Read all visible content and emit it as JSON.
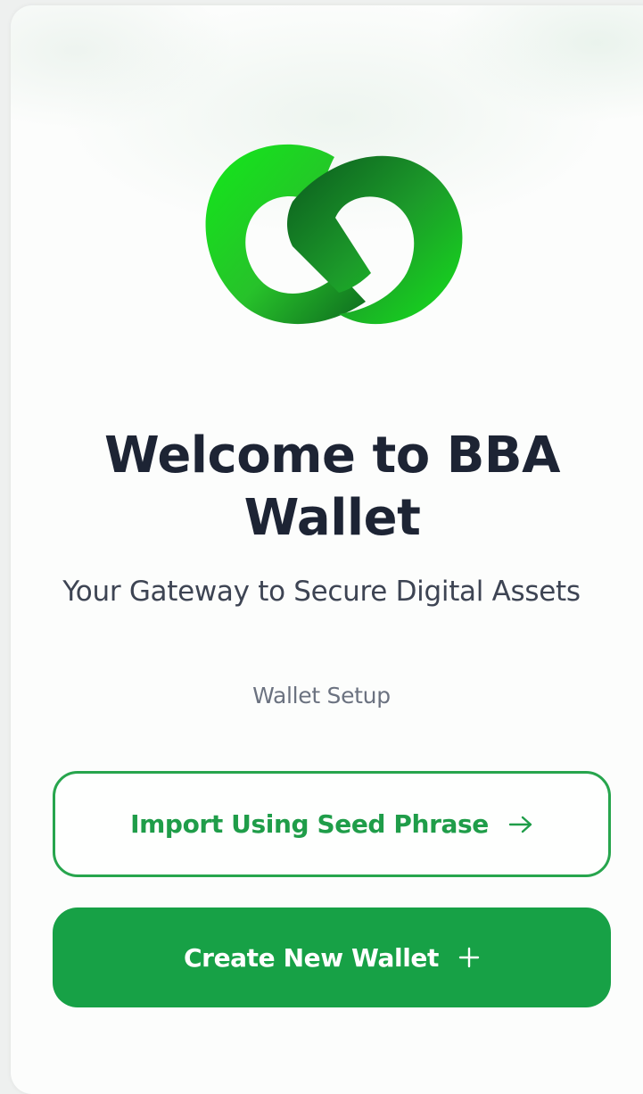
{
  "welcome": {
    "title": "Welcome to BBA Wallet",
    "subtitle": "Your Gateway to Secure Digital Assets",
    "section_label": "Wallet Setup"
  },
  "actions": {
    "import_label": "Import Using Seed Phrase",
    "import_icon": "arrow-right-icon",
    "create_label": "Create New Wallet",
    "create_icon": "plus-icon"
  },
  "colors": {
    "accent": "#17a146",
    "outline": "#27a54d",
    "title": "#1d2434",
    "subtitle": "#3d4453",
    "muted": "#6b7280"
  },
  "logo": {
    "icon": "bba-logo-icon"
  }
}
